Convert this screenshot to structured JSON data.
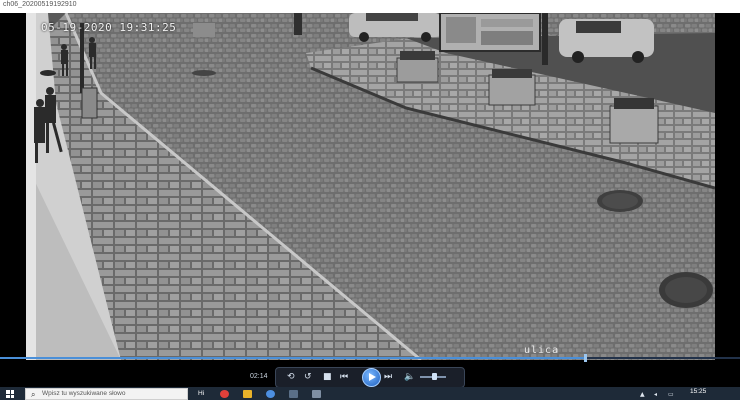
{
  "window": {
    "title": "ch06_20200519192910"
  },
  "video": {
    "osd_timestamp": "05-19-2020 19:31:25",
    "camera_label": "ulica"
  },
  "player": {
    "elapsed": "02:14",
    "progress_fraction": 0.79,
    "volume_fraction": 0.55,
    "accent_color": "#4a8fd8"
  },
  "taskbar": {
    "search_placeholder": "Wpisz tu wyszukiwane słowo",
    "task_view_label": "Hi",
    "clock_time": "15:25",
    "clock_date": "..."
  },
  "icons": {
    "start": "windows-start-icon",
    "search": "magnifier-icon",
    "loop": "loop-icon",
    "rewind": "rewind-icon",
    "stop": "stop-icon",
    "previous": "previous-icon",
    "play": "play-icon",
    "next": "next-icon",
    "volume": "speaker-icon"
  }
}
